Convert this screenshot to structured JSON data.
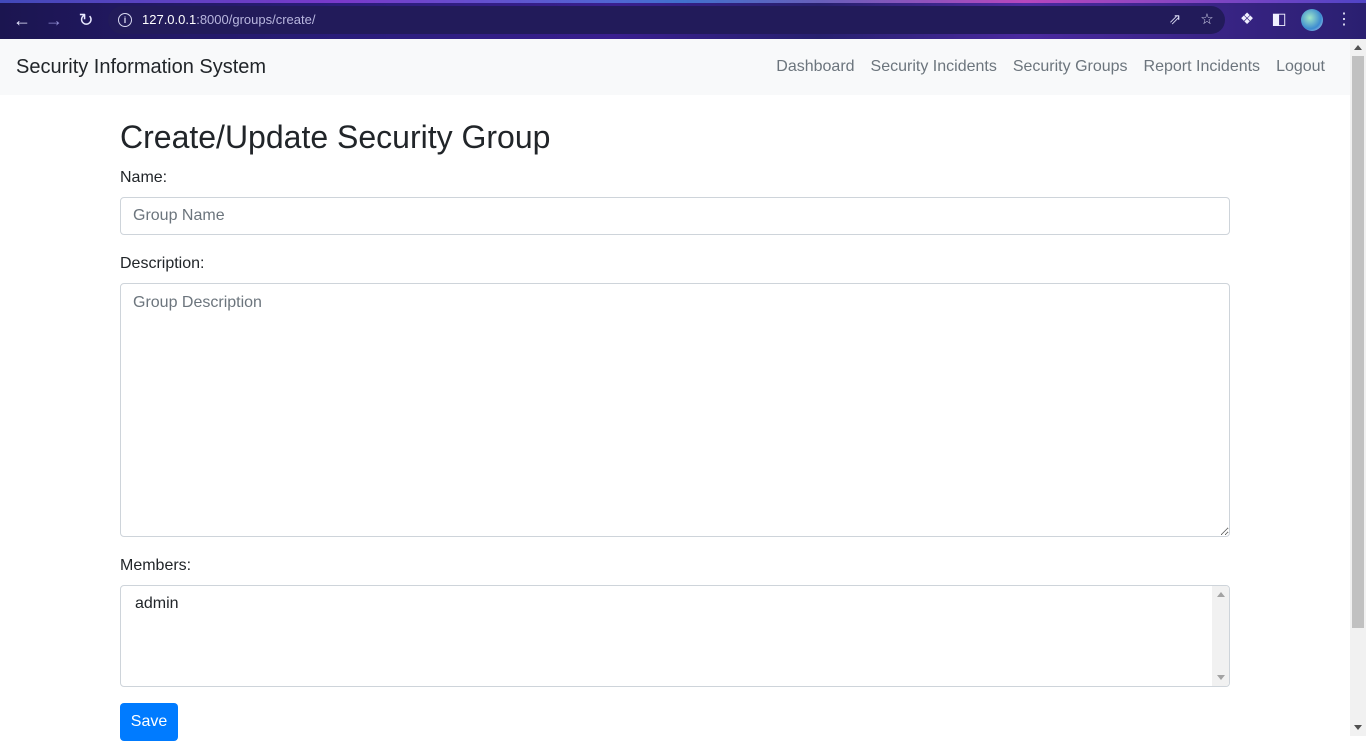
{
  "browser": {
    "url_host": "127.0.0.1",
    "url_path": ":8000/groups/create/",
    "back_icon": "back-arrow-icon",
    "forward_icon": "forward-arrow-icon",
    "reload_icon": "reload-icon"
  },
  "navbar": {
    "brand": "Security Information System",
    "links": [
      {
        "label": "Dashboard"
      },
      {
        "label": "Security Incidents"
      },
      {
        "label": "Security Groups"
      },
      {
        "label": "Report Incidents"
      },
      {
        "label": "Logout"
      }
    ]
  },
  "page": {
    "title": "Create/Update Security Group"
  },
  "form": {
    "name_label": "Name:",
    "name_placeholder": "Group Name",
    "description_label": "Description:",
    "description_placeholder": "Group Description",
    "members_label": "Members:",
    "members_options": [
      "admin"
    ],
    "save_label": "Save"
  },
  "colors": {
    "primary": "#007bff",
    "navbar_bg": "#f8f9fa",
    "nav_link": "#6c757d"
  }
}
